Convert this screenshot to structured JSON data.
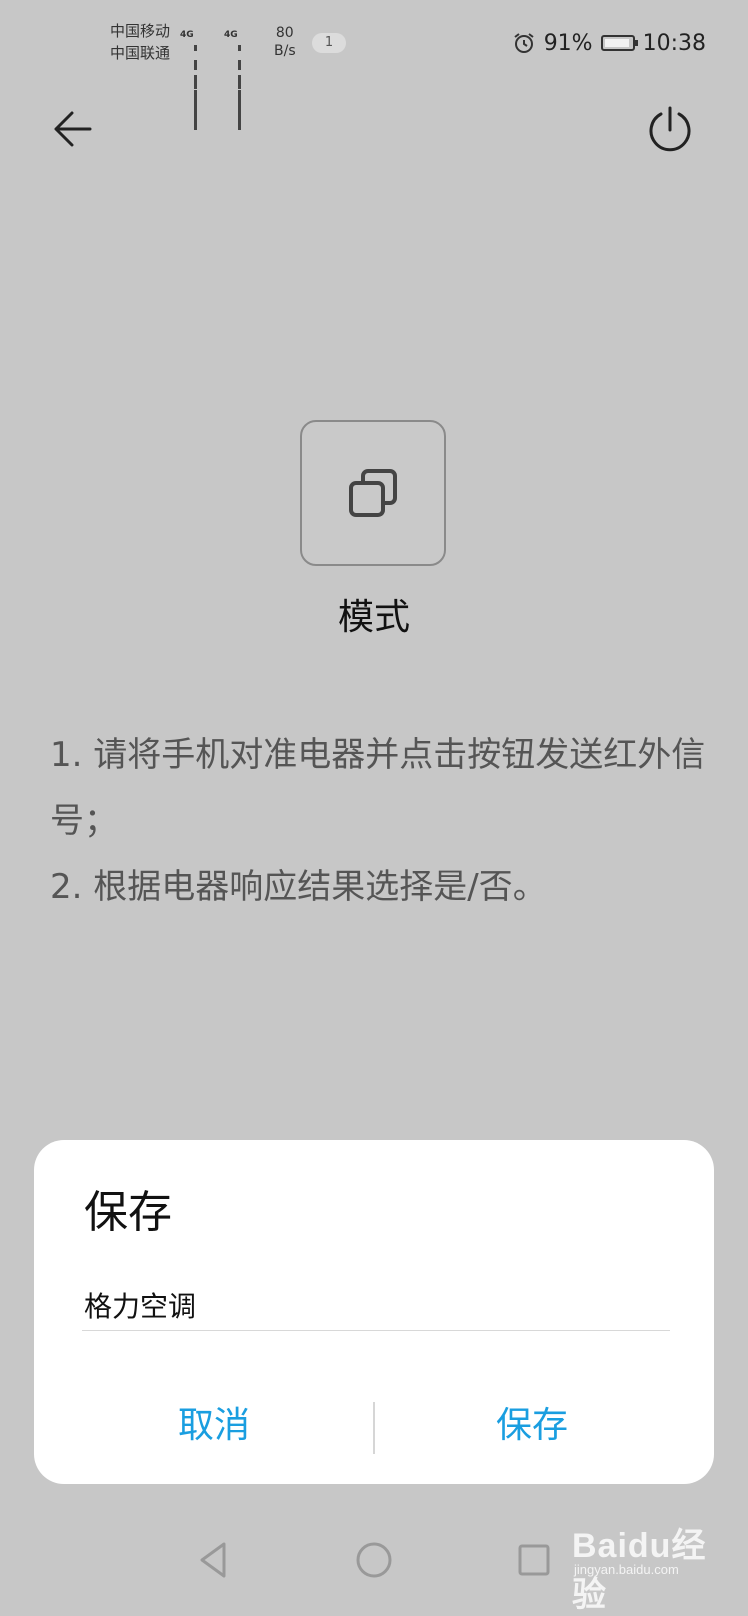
{
  "status_bar": {
    "carrier_1": "中国移动",
    "carrier_2": "中国联通",
    "network_1": "4G",
    "network_2": "4G",
    "net_speed_value": "80",
    "net_speed_unit": "B/s",
    "notification_count": "1",
    "battery_percent": "91%",
    "battery_level": 0.91,
    "time": "10:38"
  },
  "header": {
    "back_icon": "arrow-left-icon",
    "power_icon": "power-icon"
  },
  "mode": {
    "icon": "copy-icon",
    "label": "模式"
  },
  "instructions": {
    "line_1": "1. 请将手机对准电器并点击按钮发送红外信号；",
    "line_2": "2. 根据电器响应结果选择是/否。"
  },
  "dialog": {
    "title": "保存",
    "name_value": "格力空调",
    "cancel_label": "取消",
    "save_label": "保存",
    "accent_color": "#1a9ee0"
  },
  "nav_bar": {
    "back_icon": "triangle-back-icon",
    "home_icon": "circle-home-icon",
    "recent_icon": "square-recent-icon"
  },
  "watermark": {
    "main": "Baidu经验",
    "sub": "jingyan.baidu.com"
  }
}
